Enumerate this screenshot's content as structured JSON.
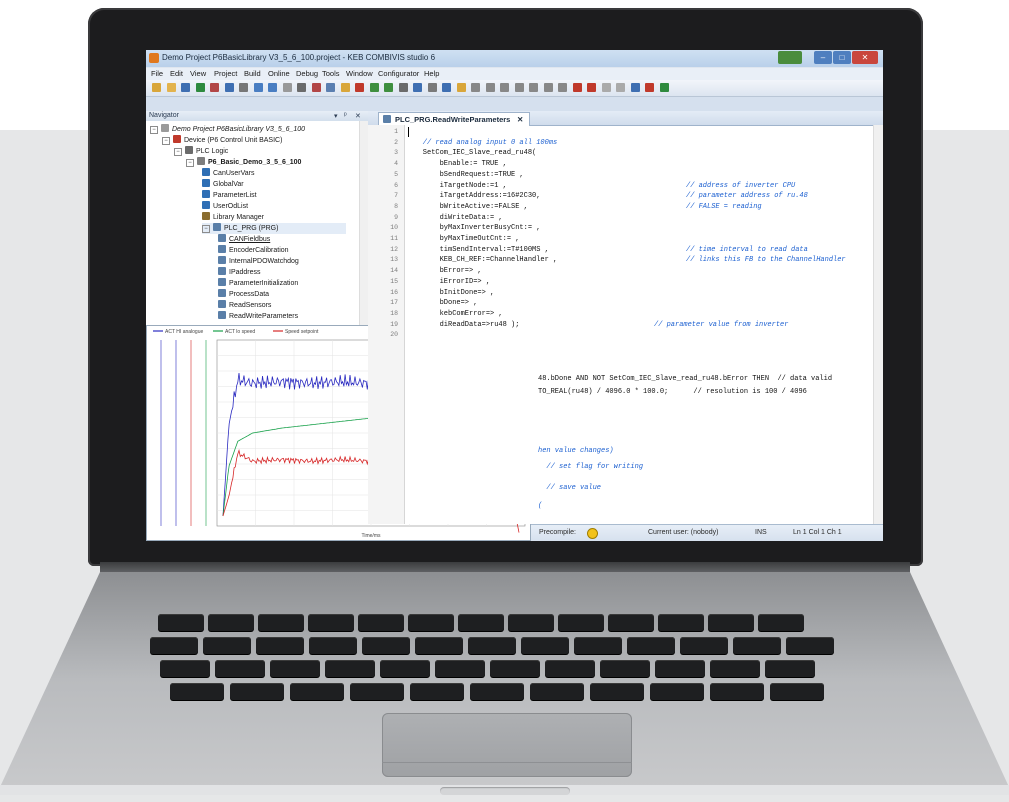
{
  "window": {
    "title": "Demo Project P6BasicLibrary V3_5_6_100.project - KEB COMBIVIS studio 6",
    "controls": [
      "–",
      "□",
      "✕"
    ]
  },
  "menu": [
    "File",
    "Edit",
    "View",
    "Project",
    "Build",
    "Online",
    "Debug",
    "Tools",
    "Window",
    "Configurator",
    "Help"
  ],
  "navigator": {
    "title": "Navigator",
    "controls": [
      "▾",
      "ᵖ",
      "✕"
    ],
    "items": [
      {
        "label": "Demo Project P6BasicLibrary V3_5_6_100",
        "indent": 0,
        "icon": "project-icon",
        "color": "#9a9a9a"
      },
      {
        "label": "Device (P6 Control Unit BASIC)",
        "indent": 1,
        "icon": "device-icon",
        "color": "#c0392b"
      },
      {
        "label": "PLC Logic",
        "indent": 2,
        "icon": "plc-icon",
        "color": "#6b6b6b"
      },
      {
        "label": "P6_Basic_Demo_3_5_6_100",
        "indent": 3,
        "icon": "application-icon",
        "color": "#7d7d7d"
      },
      {
        "label": "CanUserVars",
        "indent": 4,
        "icon": "gvl-icon",
        "color": "#2f6fb5"
      },
      {
        "label": "GlobalVar",
        "indent": 4,
        "icon": "gvl-icon",
        "color": "#2f6fb5"
      },
      {
        "label": "ParameterList",
        "indent": 4,
        "icon": "gvl-icon",
        "color": "#2f6fb5"
      },
      {
        "label": "UserOdList",
        "indent": 4,
        "icon": "gvl-icon",
        "color": "#2f6fb5"
      },
      {
        "label": "Library Manager",
        "indent": 4,
        "icon": "library-icon",
        "color": "#8a6d2f"
      },
      {
        "label": "PLC_PRG (PRG)",
        "indent": 4,
        "icon": "program-icon",
        "color": "#5a7fa8"
      },
      {
        "label": "CANFieldbus",
        "indent": 5,
        "icon": "function-block-icon",
        "color": "#5a7fa8"
      },
      {
        "label": "EncoderCalibration",
        "indent": 5,
        "icon": "function-block-icon",
        "color": "#5a7fa8"
      },
      {
        "label": "InternalPDOWatchdog",
        "indent": 5,
        "icon": "function-block-icon",
        "color": "#5a7fa8"
      },
      {
        "label": "IPaddress",
        "indent": 5,
        "icon": "function-block-icon",
        "color": "#5a7fa8"
      },
      {
        "label": "ParameterInitialization",
        "indent": 5,
        "icon": "function-block-icon",
        "color": "#5a7fa8"
      },
      {
        "label": "ProcessData",
        "indent": 5,
        "icon": "function-block-icon",
        "color": "#5a7fa8"
      },
      {
        "label": "ReadSensors",
        "indent": 5,
        "icon": "function-block-icon",
        "color": "#5a7fa8"
      },
      {
        "label": "ReadWriteParameters",
        "indent": 5,
        "icon": "function-block-icon",
        "color": "#5a7fa8"
      }
    ]
  },
  "editor": {
    "tab_label": "PLC_PRG.ReadWriteParameters",
    "line_numbers": [
      "1",
      "2",
      "3",
      "4",
      "5",
      "6",
      "7",
      "8",
      "9",
      "10",
      "11",
      "12",
      "13",
      "14",
      "15",
      "16",
      "17",
      "18",
      "19",
      "20"
    ],
    "lines": [
      "",
      "    // read analog input 0 all 100ms",
      "    SetCom_IEC_Slave_read_ru48(",
      "        bEnable:= TRUE ,",
      "        bSendRequest:=TRUE ,",
      "        iTargetNode:=1 ,",
      "        iTargetAddress:=16#2C30,",
      "        bWriteActive:=FALSE ,",
      "        diWriteData:= ,",
      "        byMaxInverterBusyCnt:= ,",
      "        byMaxTimeOutCnt:= ,",
      "        timSendInterval:=T#100MS ,",
      "        KEB_CH_REF:=ChannelHandler ,",
      "        bError=> ,",
      "        iErrorID=> ,",
      "        bInitDone=> ,",
      "        bDone=> ,",
      "        kebComError=> ,",
      "        diReadData=>ru48 );",
      ""
    ],
    "comments": {
      "c6": "// address of inverter CPU",
      "c7": "// parameter address of ru.48",
      "c8": "// FALSE = reading",
      "c12": "// time interval to read data",
      "c13": "// links this FB to the ChannelHandler",
      "c19": "// parameter value from inverter"
    },
    "fragments": {
      "f1": "48.bDone AND NOT SetCom_IEC_Slave_read_ru48.bError THEN  // data valid",
      "f2": "TO_REAL(ru48) / 4096.0 * 100.0;      // resolution is 100 / 4096",
      "f3": "hen value changes)",
      "f4": "  // set flag for writing",
      "f5": "  // save value",
      "f6": "(",
      "f7": ","
    }
  },
  "chart_data": {
    "type": "line",
    "title": "",
    "xlabel": "Time/ms",
    "ylabel": "",
    "legend": [
      "ACT HI analogue",
      "ACT lo speed",
      "Speed setpoint"
    ],
    "x": [
      0,
      2,
      5,
      10,
      20,
      30,
      40,
      50,
      60,
      70,
      80,
      90,
      95,
      100
    ],
    "series": [
      {
        "name": "ACT HI analogue",
        "color": "#2a2ac0",
        "values": [
          0,
          0.55,
          0.82,
          0.8,
          0.81,
          0.8,
          0.81,
          0.8,
          0.81,
          0.8,
          0.81,
          0.8,
          0.81,
          0.05
        ]
      },
      {
        "name": "ACT lo speed",
        "color": "#16a049",
        "values": [
          0,
          0.3,
          0.45,
          0.5,
          0.53,
          0.55,
          0.57,
          0.59,
          0.61,
          0.63,
          0.65,
          0.67,
          0.68,
          0.68
        ]
      },
      {
        "name": "Speed setpoint",
        "color": "#d62728",
        "values": [
          0,
          0.12,
          0.38,
          0.33,
          0.34,
          0.33,
          0.34,
          0.33,
          0.34,
          0.33,
          0.34,
          0.33,
          0.34,
          -0.1
        ]
      }
    ]
  },
  "status": {
    "precompile": "Precompile:",
    "user": "Current user: (nobody)",
    "mode": "INS",
    "position": "Ln 1  Col 1  Ch 1"
  },
  "colors": {
    "accent": "#2f6fb5",
    "keyword": "#0000c8",
    "comment": "#1b5fd0",
    "literal": "#b05c00"
  }
}
